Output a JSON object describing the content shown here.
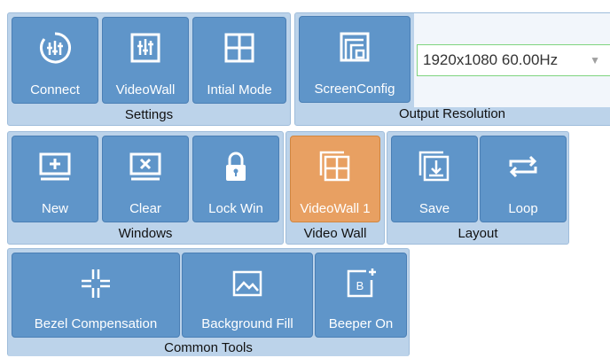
{
  "settings": {
    "label": "Settings",
    "buttons": [
      "Connect",
      "VideoWall",
      "Intial Mode"
    ]
  },
  "output": {
    "label": "Output Resolution",
    "button": "ScreenConfig",
    "resolution": "1920x1080 60.00Hz"
  },
  "windows": {
    "label": "Windows",
    "buttons": [
      "New",
      "Clear",
      "Lock Win"
    ]
  },
  "videowall": {
    "label": "Video Wall",
    "button": "VideoWall 1"
  },
  "layout": {
    "label": "Layout",
    "buttons": [
      "Save",
      "Loop"
    ]
  },
  "tools": {
    "label": "Common Tools",
    "buttons": [
      "Bezel Compensation",
      "Background Fill",
      "Beeper On"
    ]
  },
  "colors": {
    "button": "#5f95c9",
    "active": "#e8a062",
    "group": "#bcd3ea"
  }
}
